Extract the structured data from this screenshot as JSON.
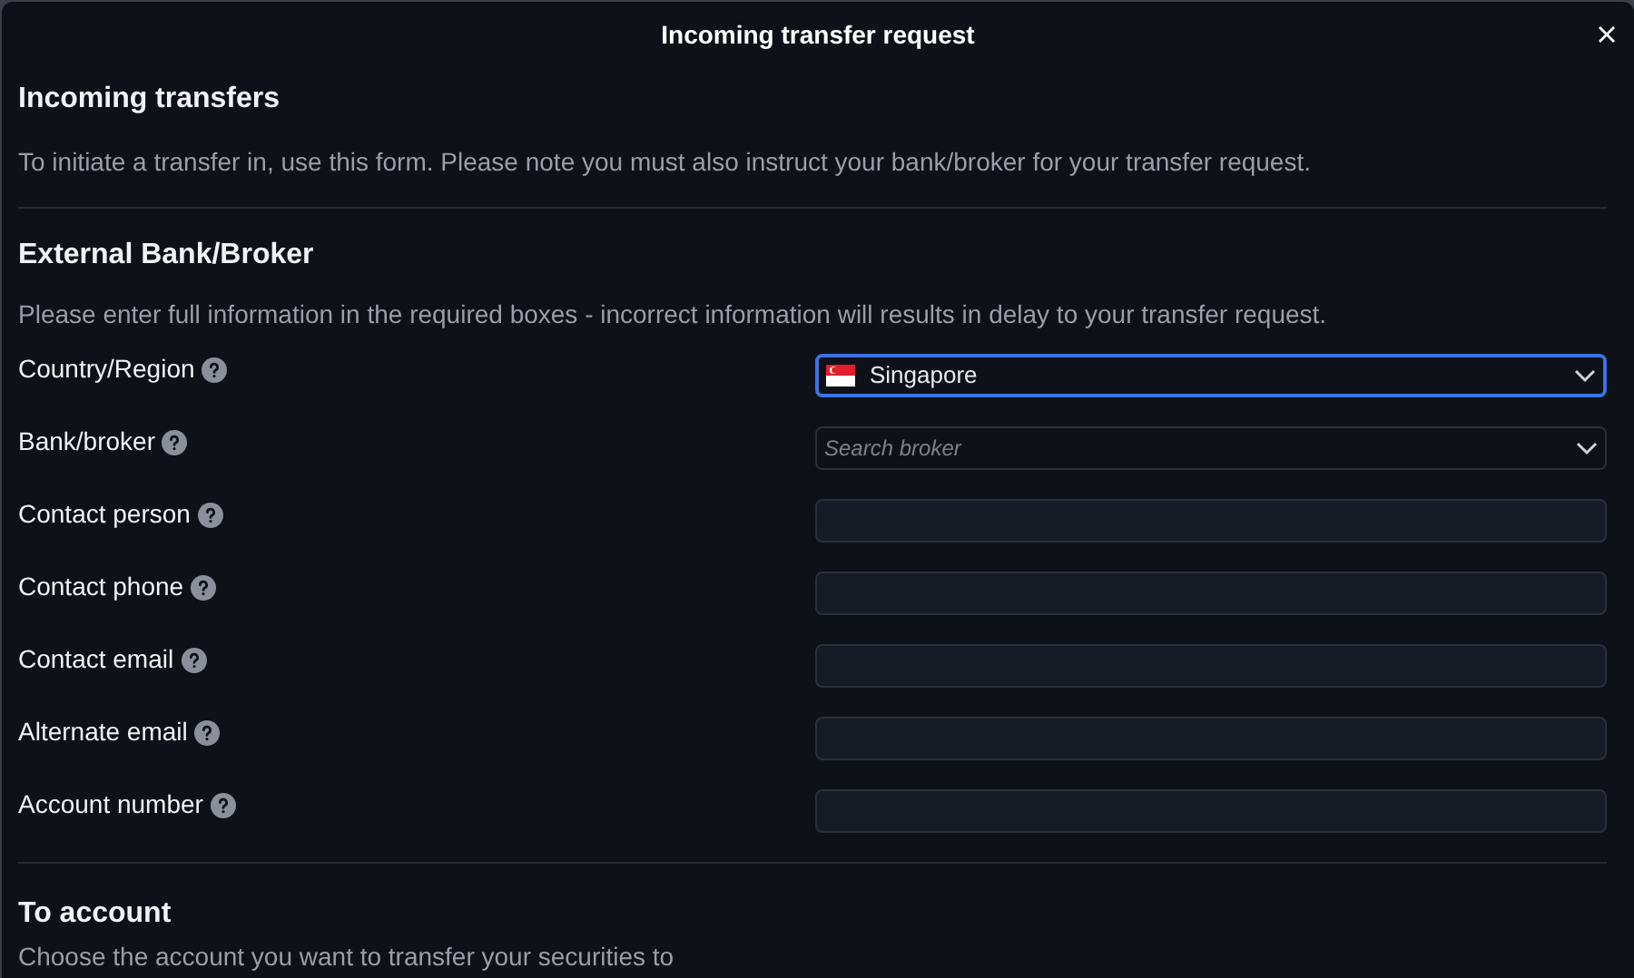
{
  "dialog": {
    "title": "Incoming transfer request"
  },
  "intro": {
    "heading": "Incoming transfers",
    "text": "To initiate a transfer in, use this form. Please note you must also instruct your bank/broker for your transfer request."
  },
  "external": {
    "heading": "External Bank/Broker",
    "text": "Please enter full information in the required boxes - incorrect information will results in delay to your transfer request.",
    "fields": [
      {
        "label": "Country/Region",
        "kind": "select",
        "value": "Singapore",
        "flag": true,
        "focused": true
      },
      {
        "label": "Bank/broker",
        "kind": "select",
        "placeholder": "Search broker",
        "focused": false
      },
      {
        "label": "Contact person",
        "kind": "text",
        "focused": false
      },
      {
        "label": "Contact phone",
        "kind": "text",
        "focused": false
      },
      {
        "label": "Contact email",
        "kind": "text",
        "focused": false
      },
      {
        "label": "Alternate email",
        "kind": "text",
        "focused": false
      },
      {
        "label": "Account number",
        "kind": "text",
        "focused": false
      }
    ]
  },
  "to_account": {
    "heading": "To account",
    "text": "Choose the account you want to transfer your securities to"
  }
}
